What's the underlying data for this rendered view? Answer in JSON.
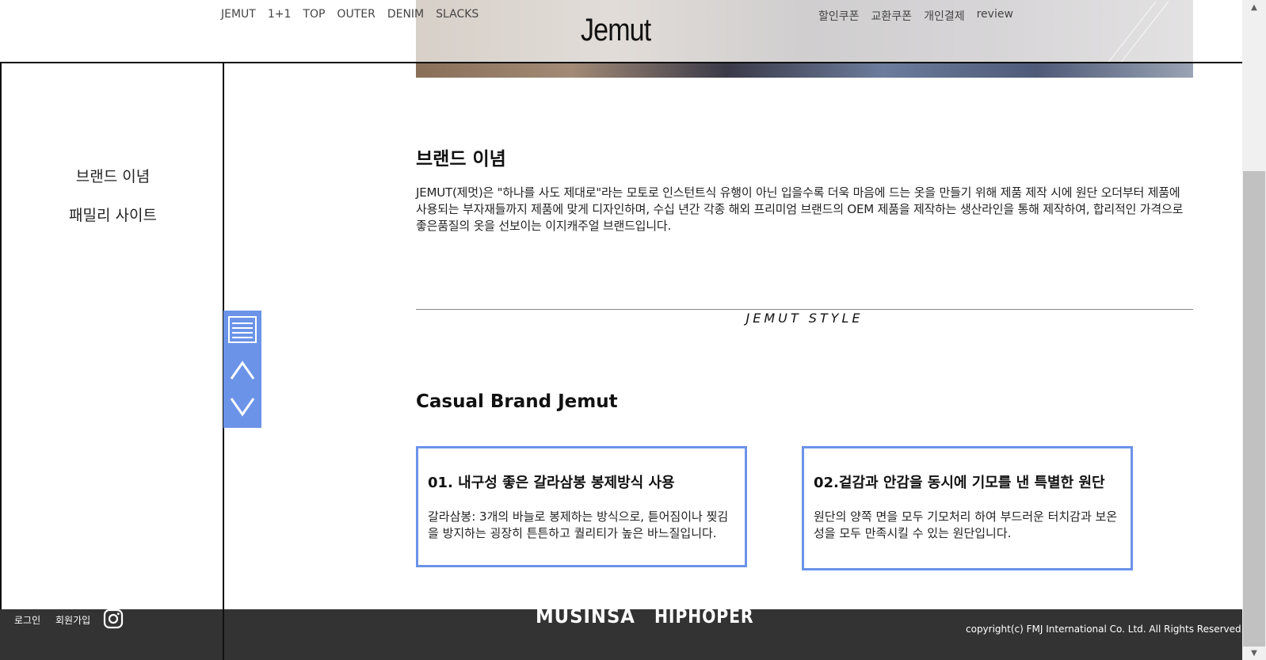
{
  "header": {
    "logo": "Jemut",
    "nav_left": [
      "JEMUT",
      "1+1",
      "TOP",
      "OUTER",
      "DENIM",
      "SLACKS"
    ],
    "nav_right": [
      "할인쿠폰",
      "교환쿠폰",
      "개인결제",
      "review"
    ]
  },
  "sidebar": {
    "items": [
      "브랜드 이념",
      "패밀리 사이트"
    ]
  },
  "widget": {
    "icons": [
      "menu-icon",
      "chevron-up-icon",
      "chevron-down-icon"
    ]
  },
  "main": {
    "brand_heading": "브랜드 이념",
    "brand_body": "JEMUT(제멋)은 \"하나를 사도 제대로\"라는 모토로 인스턴트식 유행이 아닌 입을수록 더욱 마음에 드는 옷을 만들기 위해 제품 제작 시에 원단 오더부터 제품에 사용되는 부자재들까지 제품에 맞게 디자인하며, 수십 년간 각종 해외 프리미엄 브랜드의 OEM 제품을 제작하는 생산라인을 통해 제작하여, 합리적인 가격으로 좋은품질의 옷을 선보이는 이지캐주얼 브랜드입니다.",
    "style_label": "JEMUT STYLE",
    "casual_heading": "Casual Brand Jemut",
    "cards": [
      {
        "title": "01. 내구성 좋은 갈라삼봉 봉제방식 사용",
        "body": "갈라삼봉: 3개의 바늘로 봉제하는 방식으로, 튿어짐이나 찢김을 방지하는 굉장히 튼튼하고 퀄리티가 높은 바느질입니다."
      },
      {
        "title": "02.겉감과 안감을 동시에 기모를 낸 특별한 원단",
        "body": "원단의 양쪽 면을 모두 기모처리 하여 부드러운 터치감과 보온성을 모두 만족시킬 수 있는 원단입니다."
      }
    ]
  },
  "footer": {
    "login": "로그인",
    "signup": "회원가입",
    "instagram_icon": "instagram-icon",
    "partners": [
      "MUSINSA",
      "HIPHOPER"
    ],
    "copyright": "copyright(c) FMJ International Co. Ltd. All Rights Reserved."
  },
  "colors": {
    "accent": "#6b93e8",
    "footer_bg": "#333333"
  }
}
